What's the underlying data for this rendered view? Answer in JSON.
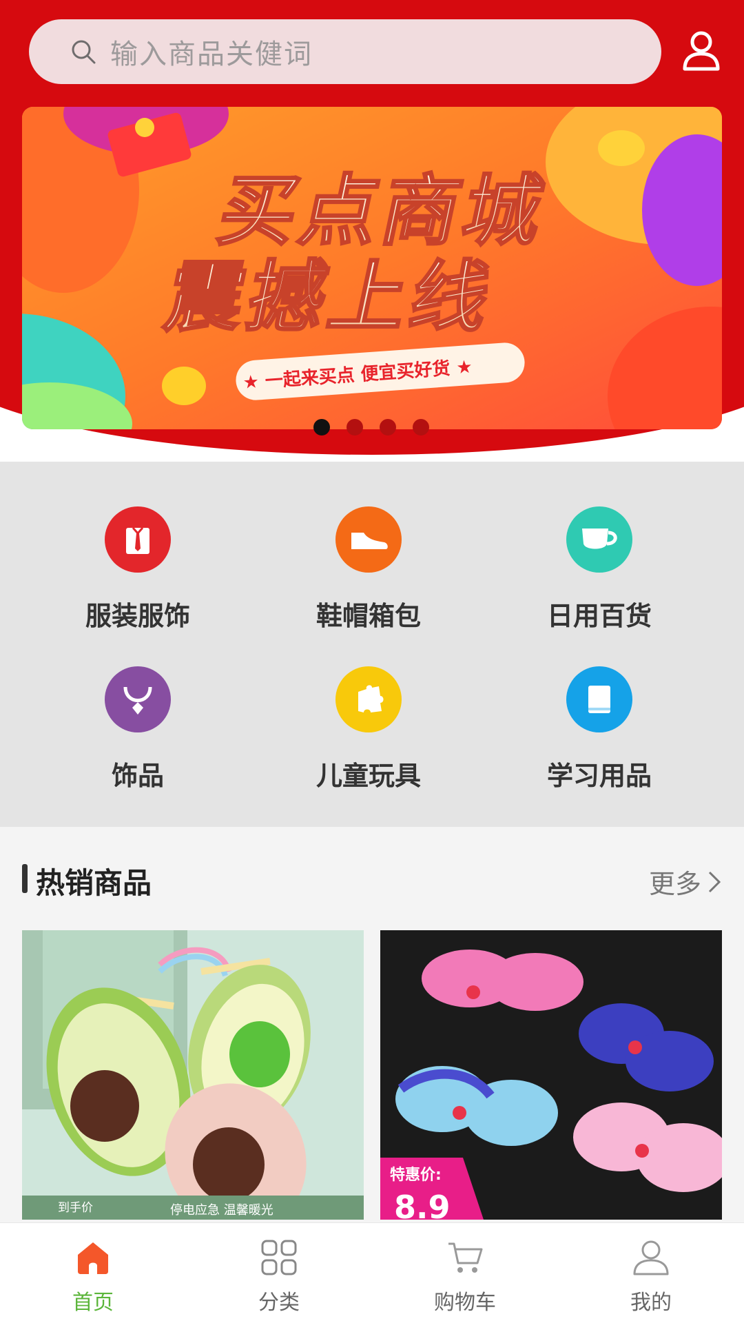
{
  "search": {
    "placeholder": "输入商品关健词"
  },
  "banner": {
    "headline_line1": "买点商城",
    "headline_line2": "震撼上线",
    "tagline": "★ 一起来买点  便宜买好货 ★",
    "dot_count": 4,
    "active_dot": 1
  },
  "categories": [
    {
      "label": "服装服饰",
      "icon": "shirt-tie-icon",
      "color": "#e3262b"
    },
    {
      "label": "鞋帽箱包",
      "icon": "shoe-icon",
      "color": "#f46a16"
    },
    {
      "label": "日用百货",
      "icon": "cup-icon",
      "color": "#2fcab2"
    },
    {
      "label": "饰品",
      "icon": "necklace-icon",
      "color": "#874ea1"
    },
    {
      "label": "儿童玩具",
      "icon": "puzzle-icon",
      "color": "#f8c90b"
    },
    {
      "label": "学习用品",
      "icon": "book-icon",
      "color": "#15a2e8"
    }
  ],
  "hot": {
    "title": "热销商品",
    "more": "更多"
  },
  "products": [
    {
      "badge": "到手价",
      "caption": "停电应急 温馨暖光"
    },
    {
      "badge": "特惠价:",
      "price": "8.9"
    }
  ],
  "tabs": [
    {
      "label": "首页",
      "icon": "home-icon",
      "active": true
    },
    {
      "label": "分类",
      "icon": "grid-icon",
      "active": false
    },
    {
      "label": "购物车",
      "icon": "cart-icon",
      "active": false
    },
    {
      "label": "我的",
      "icon": "user-icon",
      "active": false
    }
  ],
  "colors": {
    "brand_red": "#d60a0f",
    "tab_active": "#f2531e",
    "tab_home_label": "#5bb53a"
  }
}
